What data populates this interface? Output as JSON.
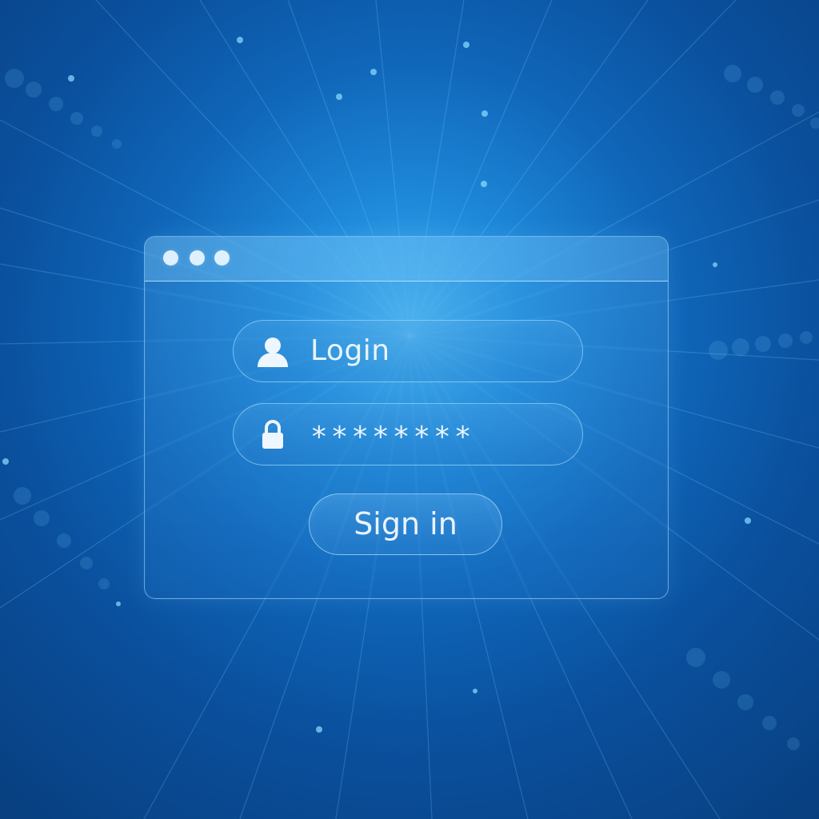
{
  "login_window": {
    "username_field": {
      "value": "Login",
      "icon": "user-icon"
    },
    "password_field": {
      "value": "********",
      "icon": "lock-icon"
    },
    "signin_button": {
      "label": "Sign in"
    },
    "window_controls": [
      {
        "icon": "window-dot-icon"
      },
      {
        "icon": "window-dot-icon"
      },
      {
        "icon": "window-dot-icon"
      }
    ]
  },
  "colors": {
    "background_center": "#35a8ea",
    "background_mid": "#0d63b7",
    "background_edge": "#083f7f",
    "glass_border": "#aae1ff",
    "text": "#f0f8ff"
  }
}
